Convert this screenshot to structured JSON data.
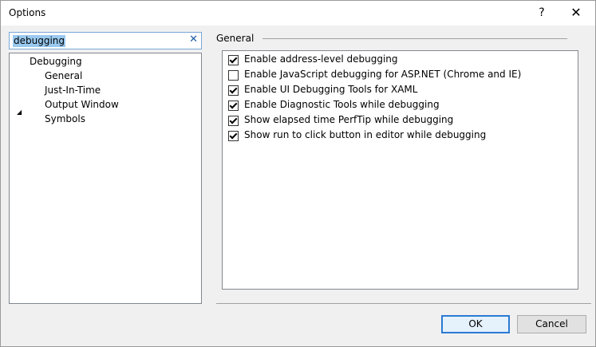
{
  "window": {
    "title": "Options",
    "help_label": "?",
    "close_label": "✕"
  },
  "search": {
    "value": "debugging",
    "clear_label": "✕"
  },
  "tree": {
    "expander_glyph": "◢",
    "root": {
      "label": "Debugging",
      "expanded": true
    },
    "children": [
      {
        "label": "General",
        "selected": true
      },
      {
        "label": "Just-In-Time"
      },
      {
        "label": "Output Window"
      },
      {
        "label": "Symbols"
      }
    ]
  },
  "section": {
    "title": "General"
  },
  "options": [
    {
      "label": "Enable address-level debugging",
      "checked": true
    },
    {
      "label": "Enable JavaScript debugging for ASP.NET (Chrome and IE)",
      "checked": false
    },
    {
      "label": "Enable UI Debugging Tools for XAML",
      "checked": true
    },
    {
      "label": "Enable Diagnostic Tools while debugging",
      "checked": true
    },
    {
      "label": "Show elapsed time PerfTip while debugging",
      "checked": true
    },
    {
      "label": "Show run to click button in editor while debugging",
      "checked": true
    }
  ],
  "buttons": {
    "ok_label": "OK",
    "cancel_label": "Cancel"
  },
  "colors": {
    "accent": "#2a7ad5",
    "selection": "#99c9ef"
  }
}
